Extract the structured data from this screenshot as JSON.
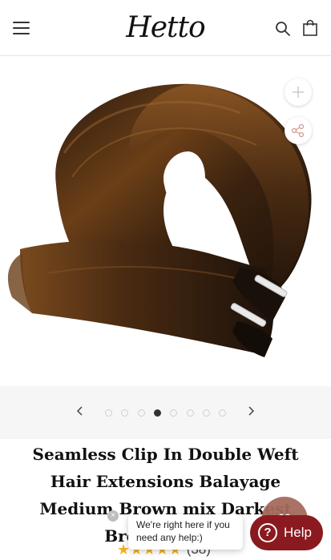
{
  "header": {
    "logo_text": "Hetto",
    "icons": {
      "menu": "hamburger-menu-icon",
      "search": "search-icon",
      "cart": "shopping-bag-icon"
    }
  },
  "gallery": {
    "image_alt": "Clip-in hair extension weft, balayage medium brown mix darkest brown",
    "buttons": {
      "zoom": "plus-icon",
      "share": "share-icon"
    },
    "pager": {
      "total_slides": 8,
      "active_index": 3
    }
  },
  "product": {
    "title": "Seamless Clip In Double Weft Hair Extensions Balayage Medium Brown mix Darkest Brown #2/2/6",
    "rating_stars": 5,
    "review_count": "(38)"
  },
  "chat": {
    "bubble_text": "We're right here if you need any help:)",
    "close_label": "×",
    "help_label": "Help",
    "help_icon": "?"
  },
  "colors": {
    "accent_help": "#8a1a1f",
    "fab": "#a56a5c",
    "star": "#f2b01e",
    "pager_bg": "#f6f6f6"
  }
}
